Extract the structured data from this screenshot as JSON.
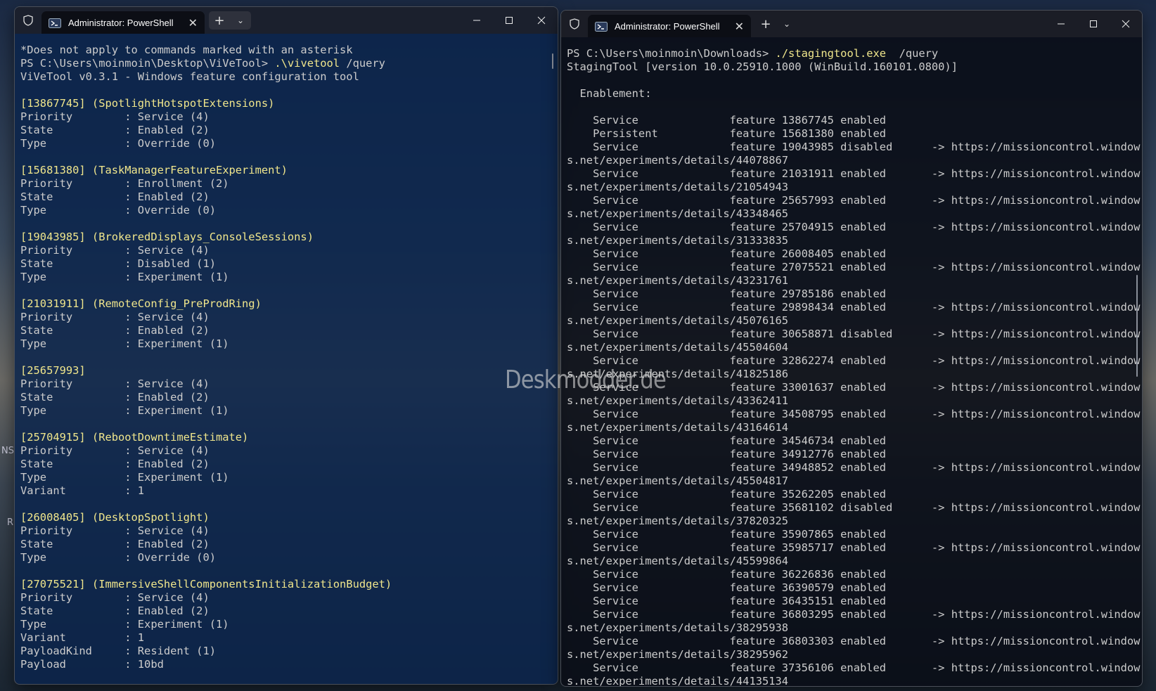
{
  "desktop": {
    "edge_text_1": "NS",
    "edge_text_2": "R"
  },
  "watermark": "Deskmodder.de",
  "left_window": {
    "tab_title": "Administrator: PowerShell",
    "lines": [
      "*Does not apply to commands marked with an asterisk",
      "PS C:\\Users\\moinmoin\\Desktop\\ViVeTool> .\\vivetool /query",
      "ViVeTool v0.3.1 - Windows feature configuration tool",
      "",
      "[13867745] (SpotlightHotspotExtensions)",
      "Priority        : Service (4)",
      "State           : Enabled (2)",
      "Type            : Override (0)",
      "",
      "[15681380] (TaskManagerFeatureExperiment)",
      "Priority        : Enrollment (2)",
      "State           : Enabled (2)",
      "Type            : Override (0)",
      "",
      "[19043985] (BrokeredDisplays_ConsoleSessions)",
      "Priority        : Service (4)",
      "State           : Disabled (1)",
      "Type            : Experiment (1)",
      "",
      "[21031911] (RemoteConfig_PreProdRing)",
      "Priority        : Service (4)",
      "State           : Enabled (2)",
      "Type            : Experiment (1)",
      "",
      "[25657993]",
      "Priority        : Service (4)",
      "State           : Enabled (2)",
      "Type            : Experiment (1)",
      "",
      "[25704915] (RebootDowntimeEstimate)",
      "Priority        : Service (4)",
      "State           : Enabled (2)",
      "Type            : Experiment (1)",
      "Variant         : 1",
      "",
      "[26008405] (DesktopSpotlight)",
      "Priority        : Service (4)",
      "State           : Enabled (2)",
      "Type            : Override (0)",
      "",
      "[27075521] (ImmersiveShellComponentsInitializationBudget)",
      "Priority        : Service (4)",
      "State           : Enabled (2)",
      "Type            : Experiment (1)",
      "Variant         : 1",
      "PayloadKind     : Resident (1)",
      "Payload         : 10bd"
    ]
  },
  "right_window": {
    "tab_title": "Administrator: PowerShell",
    "lines": [
      "PS C:\\Users\\moinmoin\\Downloads> ./stagingtool.exe  /query",
      "StagingTool [version 10.0.25910.1000 (WinBuild.160101.0800)]",
      "",
      "  Enablement:",
      "",
      "    Service              feature 13867745 enabled",
      "    Persistent           feature 15681380 enabled",
      "    Service              feature 19043985 disabled      -> https://missioncontrol.window",
      "s.net/experiments/details/44078867",
      "    Service              feature 21031911 enabled       -> https://missioncontrol.window",
      "s.net/experiments/details/21054943",
      "    Service              feature 25657993 enabled       -> https://missioncontrol.window",
      "s.net/experiments/details/43348465",
      "    Service              feature 25704915 enabled       -> https://missioncontrol.window",
      "s.net/experiments/details/31333835",
      "    Service              feature 26008405 enabled",
      "    Service              feature 27075521 enabled       -> https://missioncontrol.window",
      "s.net/experiments/details/43231761",
      "    Service              feature 29785186 enabled",
      "    Service              feature 29898434 enabled       -> https://missioncontrol.window",
      "s.net/experiments/details/45076165",
      "    Service              feature 30658871 disabled      -> https://missioncontrol.window",
      "s.net/experiments/details/45504604",
      "    Service              feature 32862274 enabled       -> https://missioncontrol.window",
      "s.net/experiments/details/41825186",
      "    Service              feature 33001637 enabled       -> https://missioncontrol.window",
      "s.net/experiments/details/43362411",
      "    Service              feature 34508795 enabled       -> https://missioncontrol.window",
      "s.net/experiments/details/43164614",
      "    Service              feature 34546734 enabled",
      "    Service              feature 34912776 enabled",
      "    Service              feature 34948852 enabled       -> https://missioncontrol.window",
      "s.net/experiments/details/45504817",
      "    Service              feature 35262205 enabled",
      "    Service              feature 35681102 disabled      -> https://missioncontrol.window",
      "s.net/experiments/details/37820325",
      "    Service              feature 35907865 enabled",
      "    Service              feature 35985717 enabled       -> https://missioncontrol.window",
      "s.net/experiments/details/45599864",
      "    Service              feature 36226836 enabled",
      "    Service              feature 36390579 enabled",
      "    Service              feature 36435151 enabled",
      "    Service              feature 36803295 enabled       -> https://missioncontrol.window",
      "s.net/experiments/details/38295938",
      "    Service              feature 36803303 enabled       -> https://missioncontrol.window",
      "s.net/experiments/details/38295962",
      "    Service              feature 37356106 enabled       -> https://missioncontrol.window",
      "s.net/experiments/details/44135134"
    ]
  }
}
